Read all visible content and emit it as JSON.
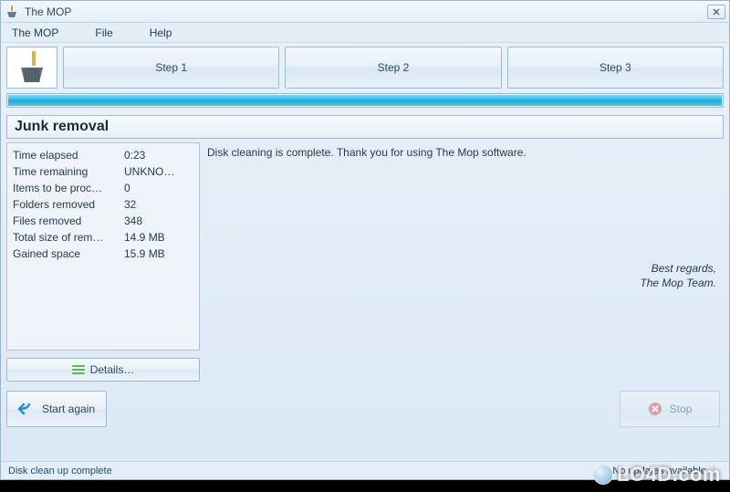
{
  "window": {
    "title": "The MOP"
  },
  "menu": {
    "items": [
      "The MOP",
      "File",
      "Help"
    ]
  },
  "steps": {
    "labels": [
      "Step 1",
      "Step 2",
      "Step 3"
    ]
  },
  "section": {
    "title": "Junk removal"
  },
  "stats": [
    {
      "label": "Time elapsed",
      "value": "0:23"
    },
    {
      "label": "Time remaining",
      "value": "UNKNO…"
    },
    {
      "label": "Items to be proc…",
      "value": "0"
    },
    {
      "label": "Folders removed",
      "value": "32"
    },
    {
      "label": "Files removed",
      "value": "348"
    },
    {
      "label": "Total size of rem…",
      "value": "14.9 MB"
    },
    {
      "label": "Gained space",
      "value": "15.9 MB"
    }
  ],
  "message": {
    "body": "Disk cleaning is complete. Thank you for using The Mop software.",
    "regards_1": "Best regards,",
    "regards_2": "The Mop Team."
  },
  "buttons": {
    "details": "Details…",
    "start_again": "Start again",
    "stop": "Stop"
  },
  "status": {
    "left": "Disk clean up complete",
    "right": "No updates available"
  },
  "watermark": "LO4D.com"
}
